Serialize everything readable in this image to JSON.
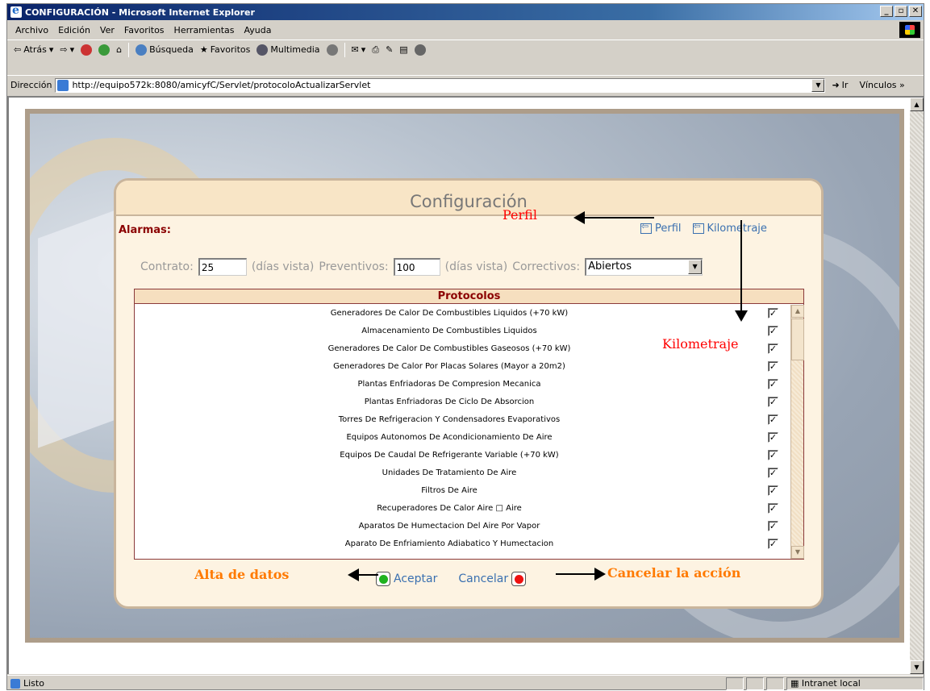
{
  "window": {
    "title": "CONFIGURACIÓN - Microsoft Internet Explorer",
    "buttons": [
      "_",
      "▫",
      "✕"
    ]
  },
  "menu": [
    "Archivo",
    "Edición",
    "Ver",
    "Favoritos",
    "Herramientas",
    "Ayuda"
  ],
  "toolbar": {
    "back": "Atrás",
    "search": "Búsqueda",
    "favorites": "Favoritos",
    "multimedia": "Multimedia"
  },
  "address": {
    "label": "Dirección",
    "url": "http://equipo572k:8080/amicyfC/Servlet/protocoloActualizarServlet",
    "go": "Ir",
    "links": "Vínculos"
  },
  "page": {
    "heading": "Configuración",
    "alarmas": "Alarmas:",
    "nav": {
      "perfil": "Perfil",
      "kilometraje": "Kilometraje"
    },
    "form": {
      "contrato_label": "Contrato:",
      "contrato_value": "25",
      "dias_vista_1": "(días vista)",
      "preventivos_label": "Preventivos:",
      "preventivos_value": "100",
      "dias_vista_2": "(días vista)",
      "correctivos_label": "Correctivos:",
      "correctivos_value": "Abiertos"
    },
    "protocolos": {
      "title": "Protocolos",
      "items": [
        "Generadores De Calor De Combustibles Liquidos (+70 kW)",
        "Almacenamiento De Combustibles Liquidos",
        "Generadores De Calor De Combustibles Gaseosos (+70 kW)",
        "Generadores De Calor Por Placas Solares (Mayor a 20m2)",
        "Plantas Enfriadoras De Compresion Mecanica",
        "Plantas Enfriadoras De Ciclo De Absorcion",
        "Torres De Refrigeracion Y Condensadores Evaporativos",
        "Equipos Autonomos De Acondicionamiento De Aire",
        "Equipos De Caudal De Refrigerante Variable (+70 kW)",
        "Unidades De Tratamiento De Aire",
        "Filtros De Aire",
        "Recuperadores De Calor Aire □ Aire",
        "Aparatos De Humectacion Del Aire Por Vapor",
        "Aparato De Enfriamiento Adiabatico Y Humectacion"
      ]
    },
    "aceptar": "Aceptar",
    "cancelar": "Cancelar"
  },
  "annotations": {
    "perfil": "Perfil",
    "kilometraje": "Kilometraje",
    "alta": "Alta de datos",
    "cancelar": "Cancelar la acción"
  },
  "status": {
    "left": "Listo",
    "zone": "Intranet local"
  },
  "colors": {
    "accent_link": "#3a70b0",
    "alarm_red": "#8b0000",
    "annotation_red": "#ff0000",
    "annotation_orange": "#ff7a00",
    "accept_green": "#1fb21f",
    "cancel_red": "#ee1111"
  }
}
